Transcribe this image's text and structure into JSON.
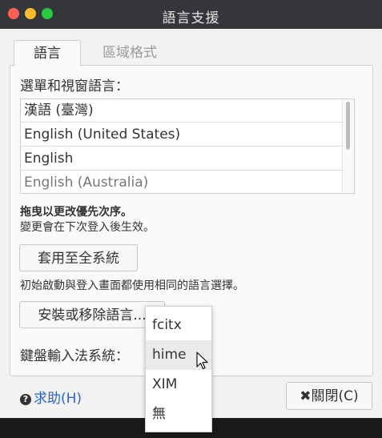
{
  "window": {
    "title": "語言支援"
  },
  "tabs": [
    {
      "label": "語言",
      "active": true
    },
    {
      "label": "區域格式",
      "active": false
    }
  ],
  "language_section": {
    "heading": "選單和視窗語言：",
    "items": [
      "漢語 (臺灣)",
      "English (United States)",
      "English",
      "English (Australia)"
    ],
    "drag_hint": "拖曳以更改優先次序。",
    "effect_hint": "變更會在下次登入後生效。"
  },
  "apply_button": "套用至全系統",
  "apply_hint": "初始啟動與登入畫面都使用相同的語言選擇。",
  "install_button": "安裝或移除語言...",
  "im_label": "鍵盤輸入法系統：",
  "im_dropdown": {
    "options": [
      "fcitx",
      "hime",
      "XIM",
      "無"
    ],
    "hovered": "hime"
  },
  "help_link": "求助(H)",
  "close_button": "關閉(C)",
  "colors": {
    "titlebar": "#343639",
    "link": "#2a66c9",
    "close_red": "#ff5f57",
    "minimize_yellow": "#febc2e",
    "zoom_green": "#28c840"
  }
}
